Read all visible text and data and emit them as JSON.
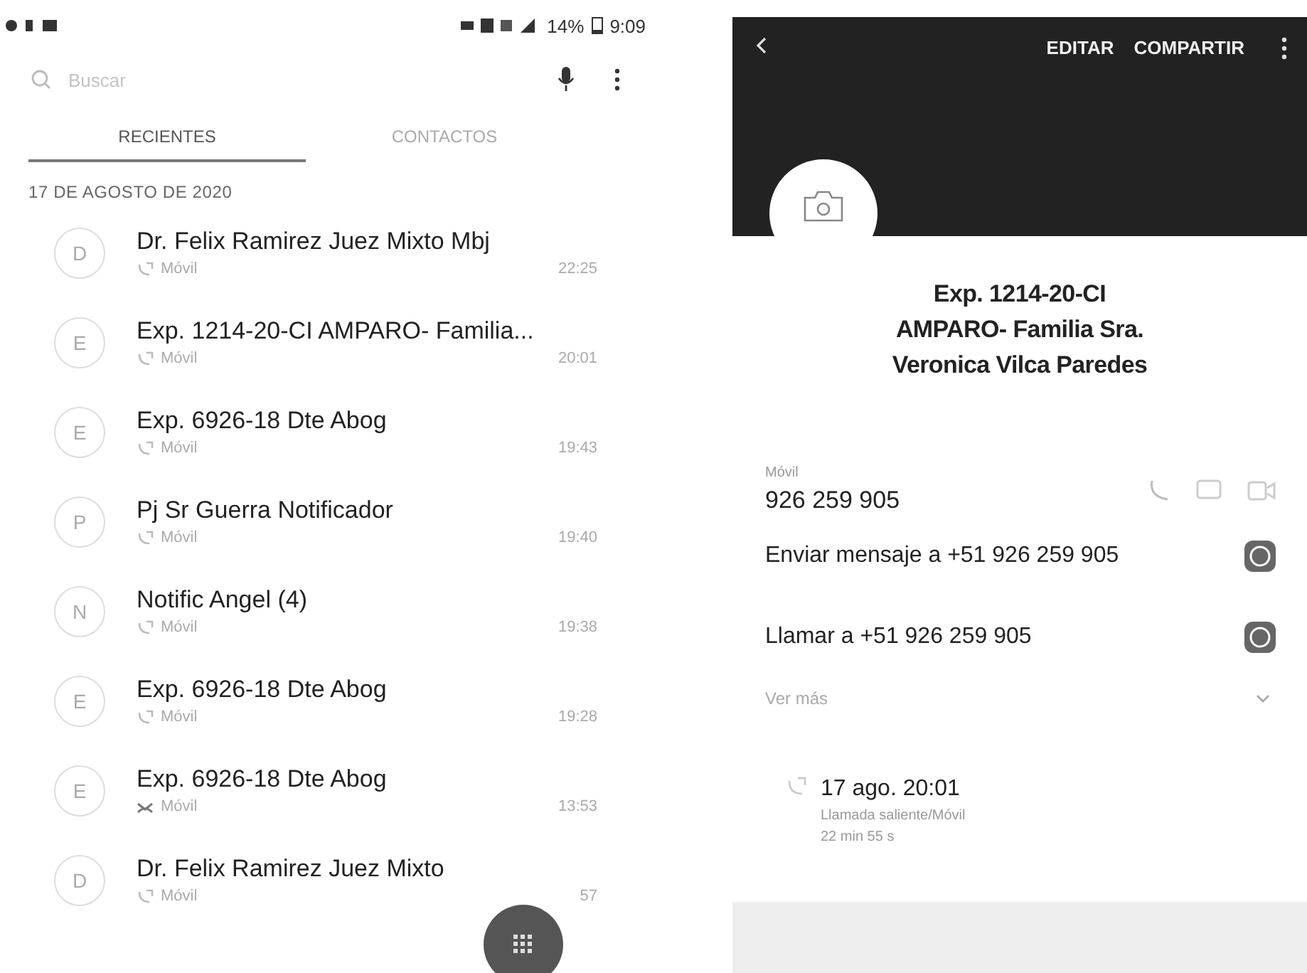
{
  "status_bar": {
    "battery": "14%",
    "time": "9:09"
  },
  "search": {
    "placeholder": "Buscar"
  },
  "tabs": [
    {
      "label": "RECIENTES",
      "selected": true
    },
    {
      "label": "CONTACTOS",
      "selected": false
    }
  ],
  "date_header": "17 DE AGOSTO DE 2020",
  "calls": [
    {
      "initial": "D",
      "name": "Dr. Felix Ramirez Juez Mixto Mbj",
      "type": "Móvil",
      "time": "22:25",
      "kind": "outgoing"
    },
    {
      "initial": "E",
      "name": "Exp. 1214-20-CI AMPARO- Familia...",
      "type": "Móvil",
      "time": "20:01",
      "kind": "outgoing"
    },
    {
      "initial": "E",
      "name": "Exp. 6926-18 Dte Abog",
      "type": "Móvil",
      "time": "19:43",
      "kind": "outgoing"
    },
    {
      "initial": "P",
      "name": "Pj Sr Guerra Notificador",
      "type": "Móvil",
      "time": "19:40",
      "kind": "outgoing"
    },
    {
      "initial": "N",
      "name": "Notific Angel (4)",
      "type": "Móvil",
      "time": "19:38",
      "kind": "outgoing"
    },
    {
      "initial": "E",
      "name": "Exp. 6926-18 Dte Abog",
      "type": "Móvil",
      "time": "19:28",
      "kind": "outgoing"
    },
    {
      "initial": "E",
      "name": "Exp. 6926-18 Dte Abog",
      "type": "Móvil",
      "time": "13:53",
      "kind": "missed"
    },
    {
      "initial": "D",
      "name": "Dr. Felix Ramirez Juez Mixto",
      "type": "Móvil",
      "time": "57",
      "kind": "outgoing"
    }
  ],
  "detail": {
    "actions": [
      "EDITAR",
      "COMPARTIR"
    ],
    "name_lines": [
      "Exp. 1214-20-CI",
      "AMPARO- Familia Sra.",
      "Veronica Vilca Paredes"
    ],
    "phone": {
      "label": "Móvil",
      "number": "926 259 905"
    },
    "whatsapp": [
      "Enviar mensaje a +51 926 259 905",
      "Llamar a +51 926 259 905"
    ],
    "see_more": "Ver más",
    "history": {
      "date": "17 ago. 20:01",
      "type": "Llamada saliente/Móvil",
      "duration": "22 min 55 s"
    }
  }
}
